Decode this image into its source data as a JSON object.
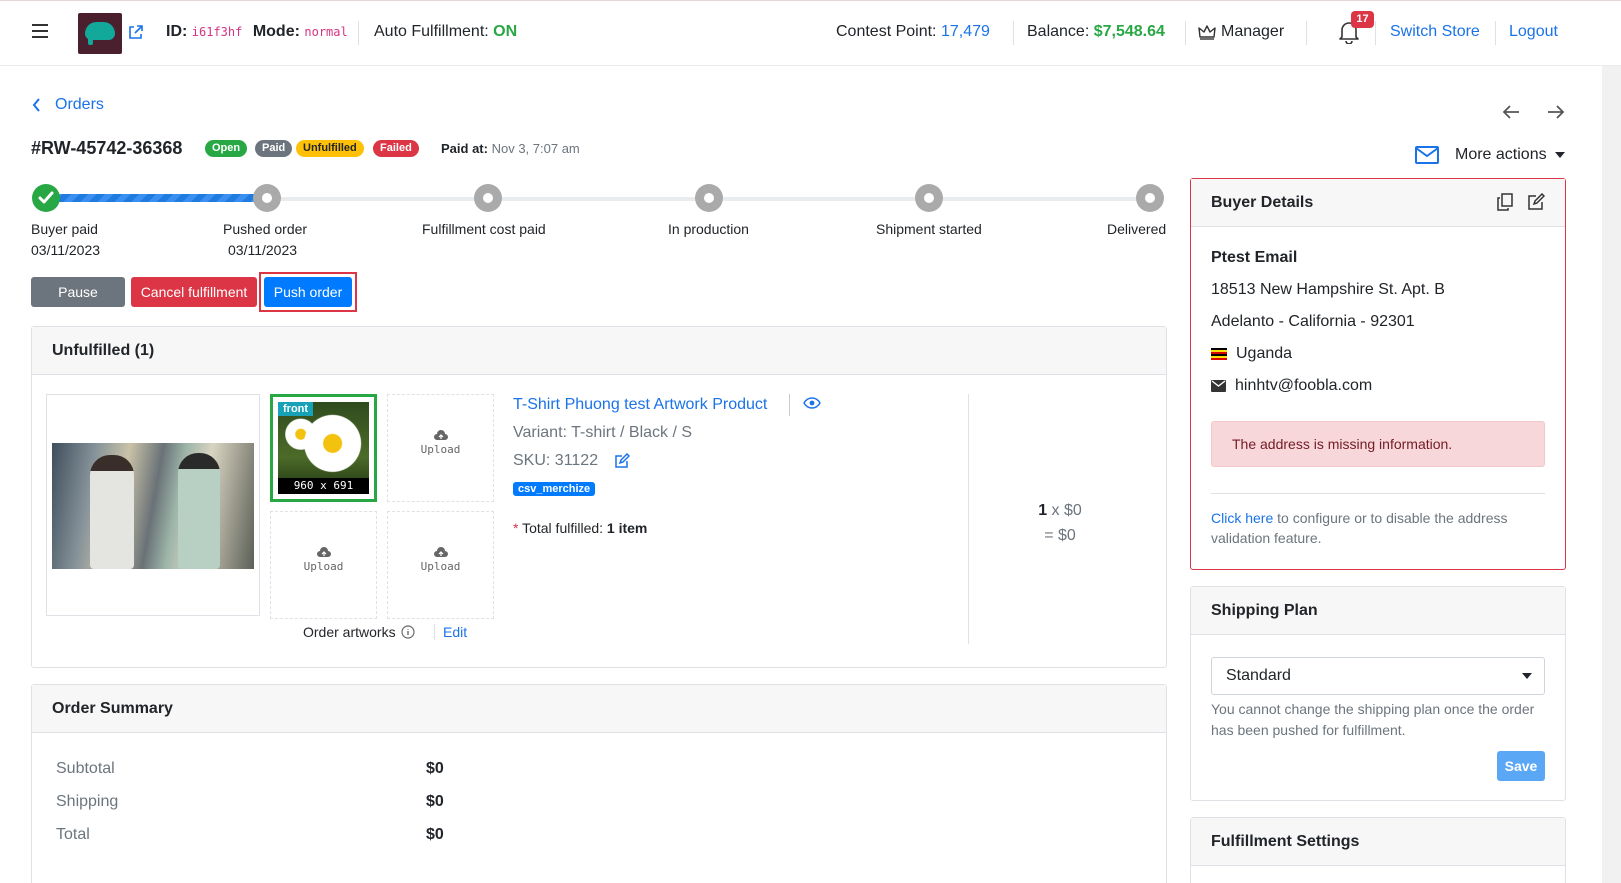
{
  "header": {
    "id_label": "ID:",
    "id_value": "i61f3hf",
    "mode_label": "Mode:",
    "mode_value": "normal",
    "auto_label": "Auto Fulfillment:",
    "auto_value": "ON",
    "contest_label": "Contest Point:",
    "contest_value": "17,479",
    "balance_label": "Balance:",
    "balance_value": "$7,548.64",
    "role": "Manager",
    "notifications": "17",
    "switch_store": "Switch Store",
    "logout": "Logout"
  },
  "breadcrumb": {
    "back_label": "Orders"
  },
  "order": {
    "number": "#RW-45742-36368",
    "badges": [
      {
        "label": "Open",
        "color": "#28a745"
      },
      {
        "label": "Paid",
        "color": "#6c757d"
      },
      {
        "label": "Unfulfilled",
        "color": "#ffc107"
      },
      {
        "label": "Failed",
        "color": "#dc3545"
      }
    ],
    "paid_at_label": "Paid at:",
    "paid_at_value": "Nov 3, 7:07 am",
    "more_actions": "More actions"
  },
  "progress": {
    "steps": [
      {
        "label": "Buyer paid",
        "date": "03/11/2023"
      },
      {
        "label": "Pushed order",
        "date": "03/11/2023"
      },
      {
        "label": "Fulfillment cost paid",
        "date": ""
      },
      {
        "label": "In production",
        "date": ""
      },
      {
        "label": "Shipment started",
        "date": ""
      },
      {
        "label": "Delivered",
        "date": ""
      }
    ]
  },
  "actions": {
    "pause": "Pause order",
    "cancel": "Cancel fulfillment",
    "push": "Push order"
  },
  "unfulfilled": {
    "title": "Unfulfilled (1)",
    "front_tag": "front",
    "front_dims": "960 x 691",
    "upload_label": "Upload",
    "artworks_label": "Order artworks",
    "edit_label": "Edit",
    "product_title": "T-Shirt Phuong test Artwork Product",
    "variant": "Variant: T-shirt / Black / S",
    "sku": "SKU:  31122",
    "tag": "csv_merchize",
    "total_fulfilled_label": "Total fulfilled:",
    "total_fulfilled_value": "1 item",
    "qty": "1",
    "qty_price": "x $0",
    "line_total": "= $0"
  },
  "summary": {
    "title": "Order Summary",
    "rows": [
      {
        "label": "Subtotal",
        "value": "$0"
      },
      {
        "label": "Shipping",
        "value": "$0"
      },
      {
        "label": "Total",
        "value": "$0"
      }
    ]
  },
  "buyer": {
    "title": "Buyer Details",
    "name": "Ptest Email",
    "address1": "18513 New Hampshire St. Apt. B",
    "address2": "Adelanto - California - 92301",
    "country": "Uganda",
    "email": "hinhtv@foobla.com",
    "alert": "The address is missing information.",
    "help_link": "Click here",
    "help_text": " to configure or to disable the address validation feature."
  },
  "shipping": {
    "title": "Shipping Plan",
    "selected": "Standard",
    "note": "You cannot change the shipping plan once the order has been pushed for fulfillment.",
    "save": "Save"
  },
  "fulfillment_settings": {
    "title": "Fulfillment Settings"
  }
}
